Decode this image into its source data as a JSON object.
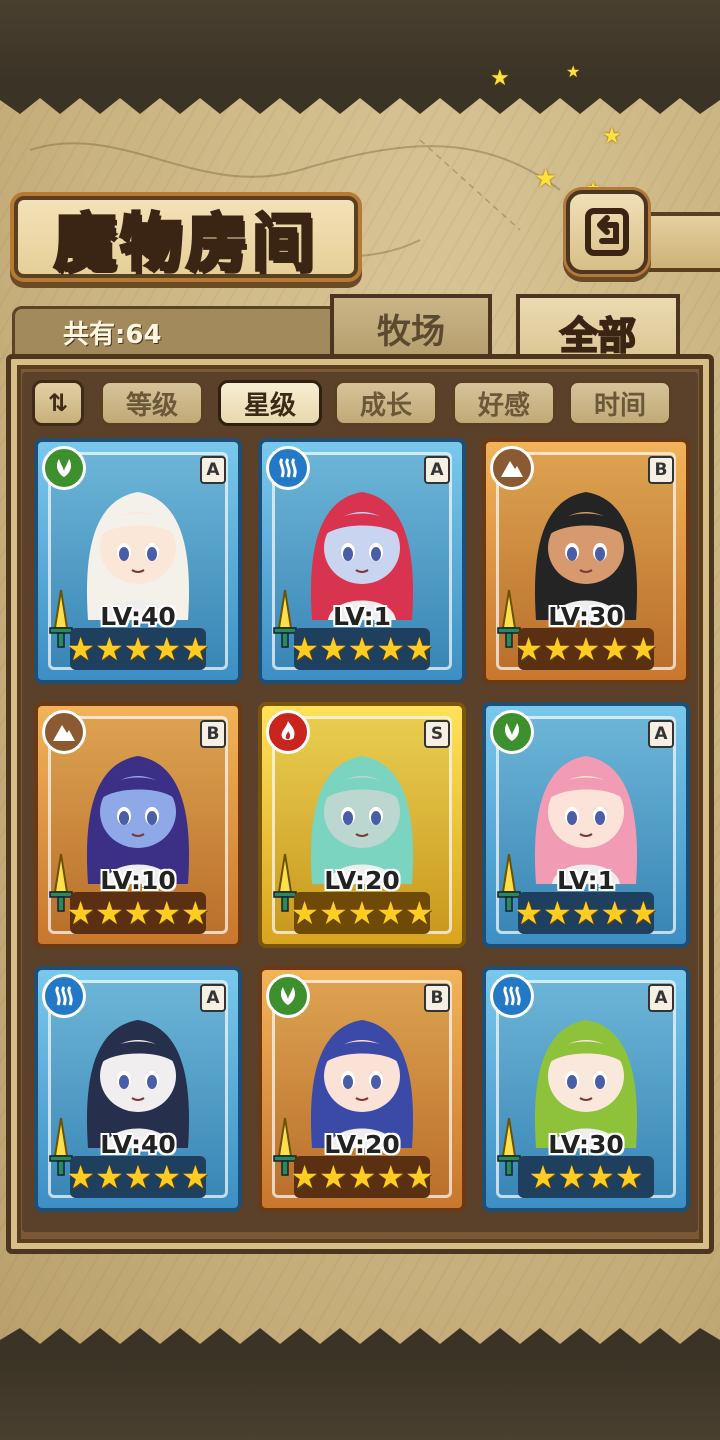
{
  "header": {
    "title": "魔物房间"
  },
  "summary": {
    "total_label": "共有:64"
  },
  "tabs": [
    {
      "label": "牧场",
      "active": false
    },
    {
      "label": "全部",
      "active": true
    }
  ],
  "sort": {
    "toggle_label": "⇅",
    "options": [
      {
        "label": "等级",
        "active": false
      },
      {
        "label": "星级",
        "active": true
      },
      {
        "label": "成长",
        "active": false
      },
      {
        "label": "好感",
        "active": false
      },
      {
        "label": "时间",
        "active": false
      }
    ]
  },
  "monsters": [
    {
      "level": "LV:40",
      "grade": "A",
      "element": "nature-icon",
      "stars": "★★★★★",
      "frame": "blue",
      "hair": "#f4f1ea",
      "skin": "#fbe7d8"
    },
    {
      "level": "LV:1",
      "grade": "A",
      "element": "water-icon",
      "stars": "★★★★★",
      "frame": "blue",
      "hair": "#d8344f",
      "skin": "#c9d4f0"
    },
    {
      "level": "LV:30",
      "grade": "B",
      "element": "earth-icon",
      "stars": "★★★★★",
      "frame": "orange",
      "hair": "#242424",
      "skin": "#d69a6e"
    },
    {
      "level": "LV:10",
      "grade": "B",
      "element": "earth-icon",
      "stars": "★★★★★",
      "frame": "orange",
      "hair": "#3b2f86",
      "skin": "#8fa8e8"
    },
    {
      "level": "LV:20",
      "grade": "S",
      "element": "fire-icon",
      "stars": "★★★★★",
      "frame": "gold",
      "hair": "#7bd4c0",
      "skin": "#bcd7cf"
    },
    {
      "level": "LV:1",
      "grade": "A",
      "element": "nature-icon",
      "stars": "★★★★★",
      "frame": "blue",
      "hair": "#f19bb4",
      "skin": "#fbe3da"
    },
    {
      "level": "LV:40",
      "grade": "A",
      "element": "water-icon",
      "stars": "★★★★★",
      "frame": "blue",
      "hair": "#26304d",
      "skin": "#f1eef0"
    },
    {
      "level": "LV:20",
      "grade": "B",
      "element": "nature-icon",
      "stars": "★★★★★",
      "frame": "orange",
      "hair": "#3b4aa6",
      "skin": "#fbe2d6"
    },
    {
      "level": "LV:30",
      "grade": "A",
      "element": "water-icon",
      "stars": "★★★★",
      "frame": "blue",
      "hair": "#8ec23b",
      "skin": "#fbe8dc"
    }
  ]
}
